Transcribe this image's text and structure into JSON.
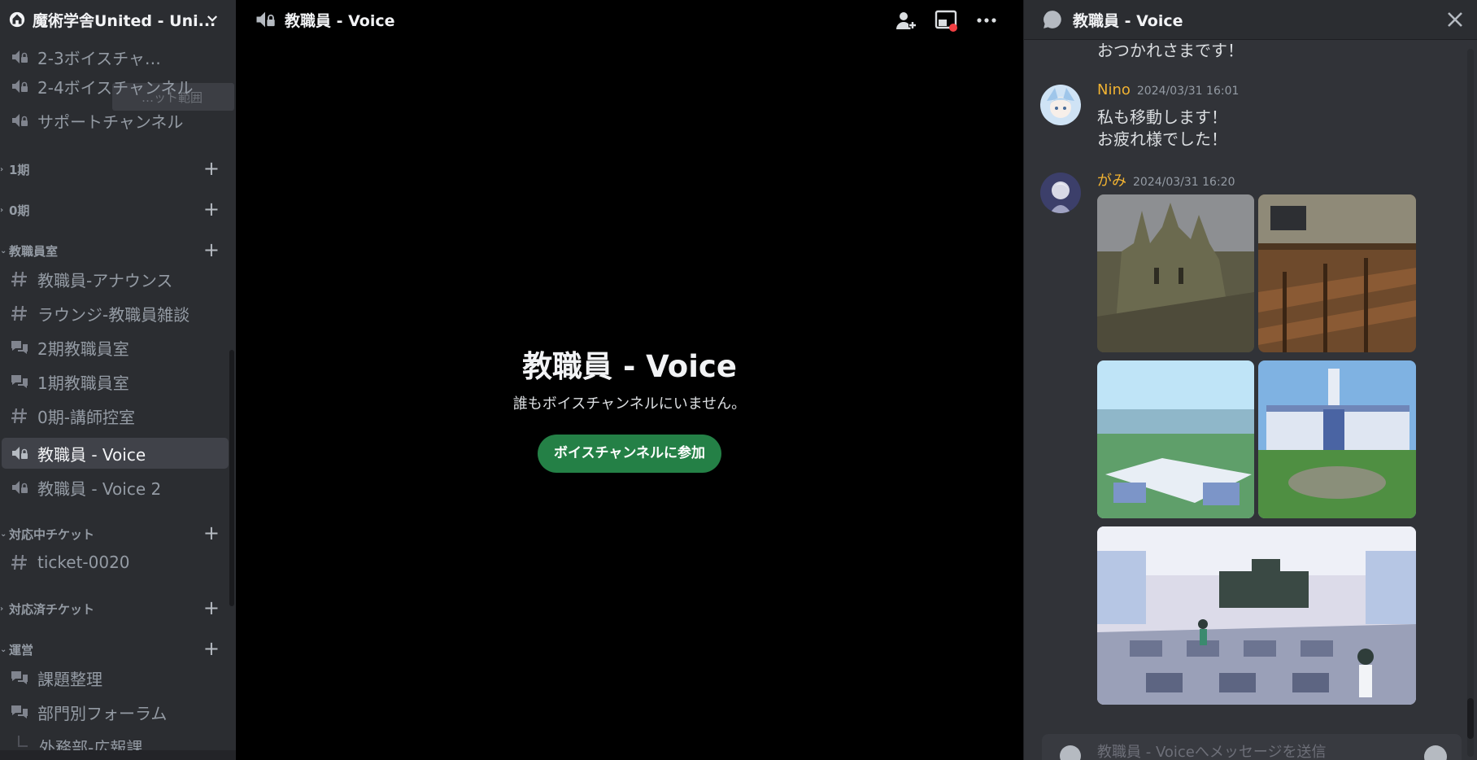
{
  "server": {
    "name": "魔術学舎United - Uni..."
  },
  "sidebar": {
    "channels_top": [
      {
        "label": "2-3ボイスチャ…",
        "icon": "voice-locked-icon"
      },
      {
        "label": "2-4ボイスチャンネル",
        "icon": "voice-locked-icon"
      },
      {
        "label": "サポートチャンネル",
        "icon": "voice-locked-icon"
      }
    ],
    "tooltip_fragment": "…ット範囲",
    "categories": [
      {
        "label": "1期"
      },
      {
        "label": "0期"
      },
      {
        "label": "教職員室"
      },
      {
        "label": "対応中チケット"
      },
      {
        "label": "対応済チケット"
      },
      {
        "label": "運営"
      }
    ],
    "staff_channels": [
      {
        "label": "教職員-アナウンス",
        "icon": "text-channel-icon"
      },
      {
        "label": "ラウンジ-教職員雑談",
        "icon": "text-channel-icon"
      },
      {
        "label": "2期教職員室",
        "icon": "forum-icon"
      },
      {
        "label": "1期教職員室",
        "icon": "forum-icon"
      },
      {
        "label": "0期-講師控室",
        "icon": "text-channel-icon"
      },
      {
        "label": "教職員 - Voice",
        "icon": "voice-locked-icon"
      },
      {
        "label": "教職員 - Voice 2",
        "icon": "voice-locked-icon"
      }
    ],
    "ticket_channels": [
      {
        "label": "ticket-0020",
        "icon": "text-channel-icon"
      }
    ],
    "ops_channels": [
      {
        "label": "課題整理",
        "icon": "forum-icon"
      },
      {
        "label": "部門別フォーラム",
        "icon": "forum-icon"
      },
      {
        "label": "外務部-広報課",
        "icon": "thread-icon"
      }
    ]
  },
  "main": {
    "channel_title": "教職員 - Voice",
    "empty_title": "教職員 - Voice",
    "empty_subtitle": "誰もボイスチャンネルにいません。",
    "join_button": "ボイスチャンネルに参加"
  },
  "chat": {
    "title": "教職員 - Voice",
    "cut_message": "おつかれさまです！",
    "messages": [
      {
        "user": "Nino",
        "timestamp": "2024/03/31 16:01",
        "lines": [
          "私も移動します！",
          "お疲れ様でした！"
        ],
        "name_color": "#f0b232"
      },
      {
        "user": "がみ",
        "timestamp": "2024/03/31 16:20",
        "images": [
          "castle-model-photo",
          "dining-hall-photo",
          "academy-campus-aerial",
          "academy-building-illustration",
          "classroom-scene-illustration"
        ],
        "name_color": "#f0b232"
      }
    ],
    "input_placeholder": "教職員 - Voiceへメッセージを送信"
  },
  "colors": {
    "sidebar_bg": "#2b2d31",
    "chat_bg": "#313338",
    "join_button": "#248046",
    "active_channel": "#404249",
    "username": "#f0b232"
  }
}
